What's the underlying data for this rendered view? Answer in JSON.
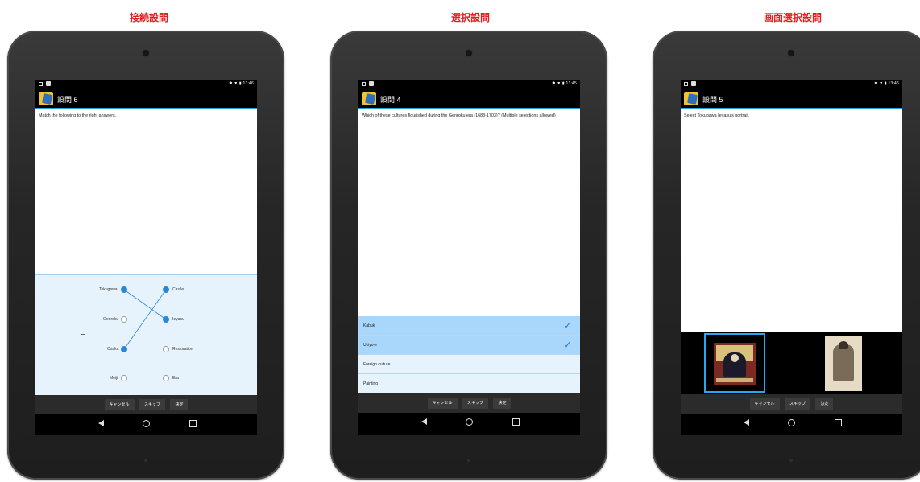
{
  "captions": [
    "接続設問",
    "選択設問",
    "画面選択設問"
  ],
  "buttons": {
    "cancel": "キャンセル",
    "skip": "スキップ",
    "decide": "決定"
  },
  "devices": [
    {
      "status_time": "13:46",
      "title": "設問 6",
      "question": "Match the following to the right answers.",
      "left_items": [
        "Tokugawa",
        "Genroku",
        "Osaka",
        "Meiji"
      ],
      "right_items": [
        "Castle",
        "Ieyasu",
        "Restoration",
        "Era"
      ],
      "connections": [
        [
          "Tokugawa",
          "Ieyasu"
        ],
        [
          "Osaka",
          "Castle"
        ]
      ]
    },
    {
      "status_time": "13:45",
      "title": "設問 4",
      "question": "Which of these cultures flourished during the Genroku era (1688-1703)? (Multiple selections allowed)",
      "options": [
        {
          "label": "Kabuki",
          "selected": true
        },
        {
          "label": "Ukiyo-e",
          "selected": true
        },
        {
          "label": "Foreign culture",
          "selected": false
        },
        {
          "label": "Painting",
          "selected": false
        }
      ],
      "check_icon": "✓"
    },
    {
      "status_time": "13:46",
      "title": "設問 5",
      "question": "Select Tokugawa Ieyasu's portrait.",
      "images": [
        {
          "name": "portrait-seated-icon",
          "selected": true
        },
        {
          "name": "portrait-armored-icon",
          "selected": false
        }
      ]
    }
  ],
  "colors": {
    "caption": "#e02020",
    "accent": "#2aa0e0",
    "selected_option": "#a9d6fb",
    "node_on": "#2b86d4"
  }
}
